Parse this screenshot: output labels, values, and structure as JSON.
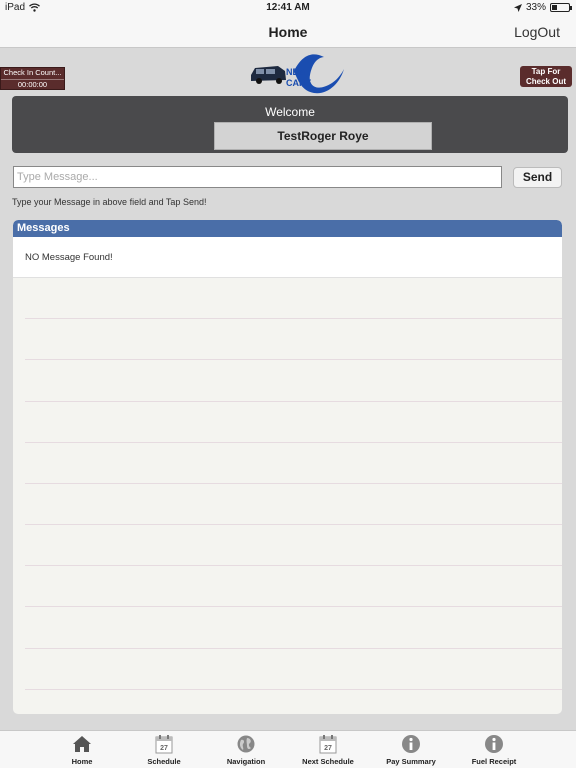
{
  "status_bar": {
    "device": "iPad",
    "time": "12:41 AM",
    "battery": "33%",
    "battery_level": 0.33
  },
  "nav": {
    "title": "Home",
    "logout_label": "LogOut"
  },
  "checkin": {
    "label": "Check In Count...",
    "time": "00:00:00"
  },
  "checkout": {
    "line1": "Tap For",
    "line2": "Check Out"
  },
  "logo": {
    "line1": "NEMT",
    "line2": "CARE"
  },
  "welcome": {
    "label": "Welcome",
    "name": "TestRoger Roye"
  },
  "compose": {
    "placeholder": "Type Message...",
    "value": "",
    "send_label": "Send",
    "hint": "Type your Message in above field and Tap Send!"
  },
  "messages": {
    "header": "Messages",
    "empty_text": "NO Message Found!"
  },
  "tabs": [
    {
      "label": "Home",
      "icon": "home-icon"
    },
    {
      "label": "Schedule",
      "icon": "calendar-icon",
      "badge": "27"
    },
    {
      "label": "Navigation",
      "icon": "globe-icon"
    },
    {
      "label": "Next Schedule",
      "icon": "calendar-icon",
      "badge": "27"
    },
    {
      "label": "Pay Summary",
      "icon": "info-icon"
    },
    {
      "label": "Fuel Receipt",
      "icon": "info-icon"
    }
  ],
  "colors": {
    "accent_header": "#4a6ea8",
    "checkin_bg": "#5a2c2c",
    "welcome_bg": "#4a4a4c",
    "logo_blue": "#1a4db0"
  }
}
